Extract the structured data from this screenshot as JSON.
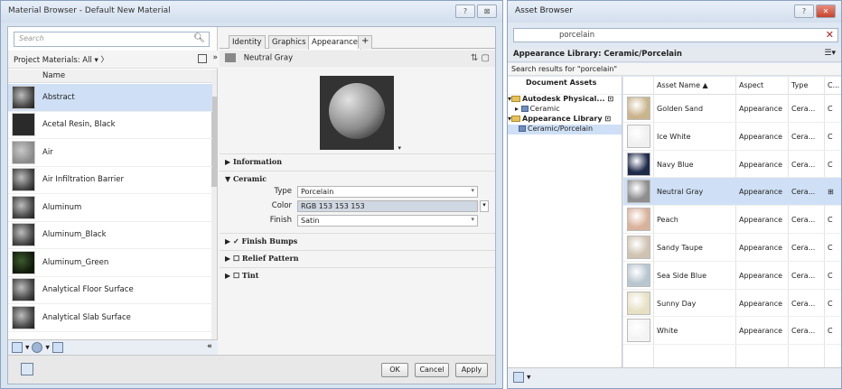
{
  "material_browser": {
    "title": "Material Browser - Default New Material",
    "help_btn": "?",
    "close_btn": "⊠",
    "search_placeholder": "Search",
    "project_filter": "Project Materials: All",
    "name_header": "Name",
    "materials": [
      {
        "name": "Abstract",
        "thumb": "sphere",
        "selected": true
      },
      {
        "name": "Acetal Resin, Black",
        "thumb": "dark",
        "selected": false
      },
      {
        "name": "Air",
        "thumb": "light",
        "selected": false
      },
      {
        "name": "Air Infiltration Barrier",
        "thumb": "sphere",
        "selected": false
      },
      {
        "name": "Aluminum",
        "thumb": "sphere",
        "selected": false
      },
      {
        "name": "Aluminum_Black",
        "thumb": "sphere",
        "selected": false
      },
      {
        "name": "Aluminum_Green",
        "thumb": "green",
        "selected": false
      },
      {
        "name": "Analytical Floor Surface",
        "thumb": "sphere",
        "selected": false
      },
      {
        "name": "Analytical Slab Surface",
        "thumb": "sphere",
        "selected": false
      }
    ],
    "collapse_label": "«",
    "tabs": [
      "Identity",
      "Graphics",
      "Appearance",
      "+"
    ],
    "active_tab": "Appearance",
    "asset_name": "Neutral Gray",
    "sections": {
      "information": "Information",
      "ceramic": "Ceramic",
      "finish_bumps": "Finish Bumps",
      "relief_pattern": "Relief Pattern",
      "tint": "Tint"
    },
    "props": {
      "type_label": "Type",
      "type_value": "Porcelain",
      "color_label": "Color",
      "color_value": "RGB 153 153 153",
      "finish_label": "Finish",
      "finish_value": "Satin"
    },
    "buttons": {
      "ok": "OK",
      "cancel": "Cancel",
      "apply": "Apply"
    }
  },
  "asset_browser": {
    "title": "Asset Browser",
    "search_value": "porcelain",
    "library_title": "Appearance Library: Ceramic/Porcelain",
    "results_text": "Search results for \"porcelain\"",
    "tree": {
      "document_assets": "Document Assets",
      "autodesk_physical": "Autodesk Physical...",
      "ceramic": "Ceramic",
      "appearance_library": "Appearance Library",
      "ceramic_porcelain": "Ceramic/Porcelain"
    },
    "columns": {
      "asset_name": "Asset Name",
      "aspect": "Aspect",
      "type": "Type",
      "category": "C..."
    },
    "assets": [
      {
        "name": "Golden Sand",
        "aspect": "Appearance",
        "type": "Cera...",
        "cat": "C",
        "color": "#c9b48c"
      },
      {
        "name": "Ice White",
        "aspect": "Appearance",
        "type": "Cera...",
        "cat": "C",
        "color": "#f0f0f0"
      },
      {
        "name": "Navy Blue",
        "aspect": "Appearance",
        "type": "Cera...",
        "cat": "C",
        "color": "#1e2a4a"
      },
      {
        "name": "Neutral Gray",
        "aspect": "Appearance",
        "type": "Cera...",
        "cat": "⊞",
        "color": "#8e8e8e"
      },
      {
        "name": "Peach",
        "aspect": "Appearance",
        "type": "Cera...",
        "cat": "C",
        "color": "#d8b29a"
      },
      {
        "name": "Sandy Taupe",
        "aspect": "Appearance",
        "type": "Cera...",
        "cat": "C",
        "color": "#cfc3b1"
      },
      {
        "name": "Sea Side Blue",
        "aspect": "Appearance",
        "type": "Cera...",
        "cat": "C",
        "color": "#b7c6cf"
      },
      {
        "name": "Sunny Day",
        "aspect": "Appearance",
        "type": "Cera...",
        "cat": "C",
        "color": "#e6e0c4"
      },
      {
        "name": "White",
        "aspect": "Appearance",
        "type": "Cera...",
        "cat": "C",
        "color": "#f4f4f4"
      }
    ],
    "selected_asset": "Neutral Gray"
  }
}
